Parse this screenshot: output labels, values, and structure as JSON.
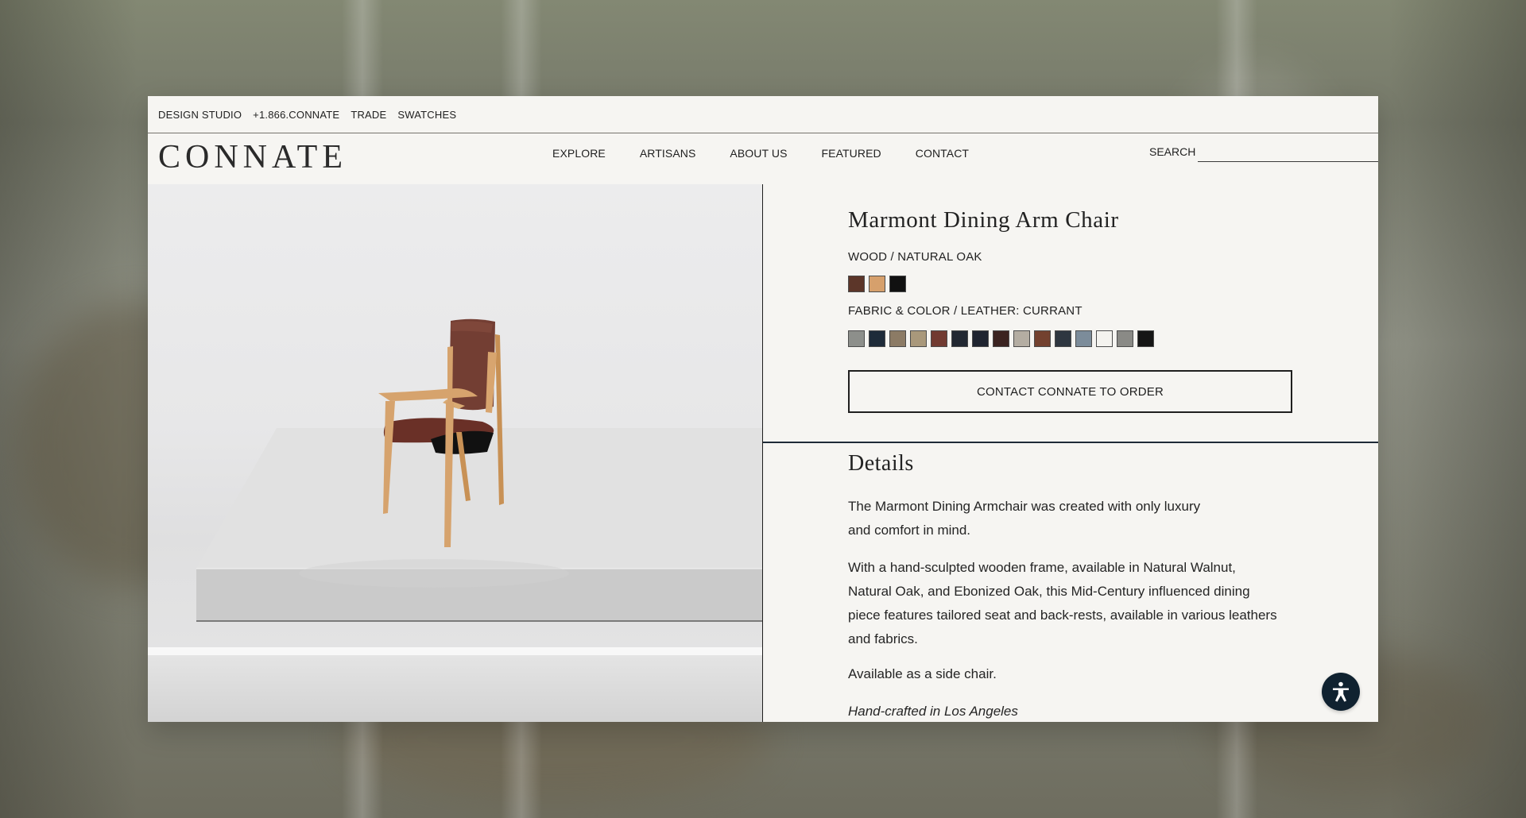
{
  "utility_bar": {
    "items": [
      {
        "label": "DESIGN STUDIO"
      },
      {
        "label": "+1.866.CONNATE"
      },
      {
        "label": "TRADE"
      },
      {
        "label": "SWATCHES"
      }
    ]
  },
  "header": {
    "logo": "CONNATE",
    "nav": [
      {
        "label": "EXPLORE"
      },
      {
        "label": "ARTISANS"
      },
      {
        "label": "ABOUT US"
      },
      {
        "label": "FEATURED"
      },
      {
        "label": "CONTACT"
      }
    ],
    "search_label": "SEARCH",
    "search_value": "",
    "search_placeholder": ""
  },
  "product": {
    "title": "Marmont Dining Arm Chair",
    "wood_label": "WOOD / NATURAL OAK",
    "wood_swatches": [
      "#5c3629",
      "#d6a06c",
      "#111111"
    ],
    "fabric_label": "FABRIC & COLOR / LEATHER: CURRANT",
    "fabric_swatches": [
      "#8d8f8b",
      "#1e2b39",
      "#8c7b65",
      "#a9987b",
      "#713a31",
      "#222832",
      "#1f2430",
      "#3b2320",
      "#b4ada2",
      "#73412f",
      "#2e3640",
      "#7c8c9a",
      "#f4f3ef",
      "#8a8a86",
      "#151515"
    ],
    "cta": "CONTACT CONNATE TO ORDER"
  },
  "details": {
    "title": "Details",
    "paragraphs": [
      "The Marmont Dining Armchair was created with only luxury and comfort in mind.",
      "With a hand-sculpted wooden frame, available in Natural Walnut, Natural Oak, and Ebonized Oak, this Mid-Century influenced dining piece features tailored seat and back-rests, available in various leathers and fabrics.",
      "Available as a side chair.",
      "Hand-crafted in Los Angeles"
    ]
  },
  "accessibility": {
    "icon": "accessibility-person-icon"
  },
  "colors": {
    "page_background": "#f6f5f2",
    "text": "#1f1f1f",
    "accent_dark": "#102230",
    "image_background": "#e7e7e8"
  }
}
